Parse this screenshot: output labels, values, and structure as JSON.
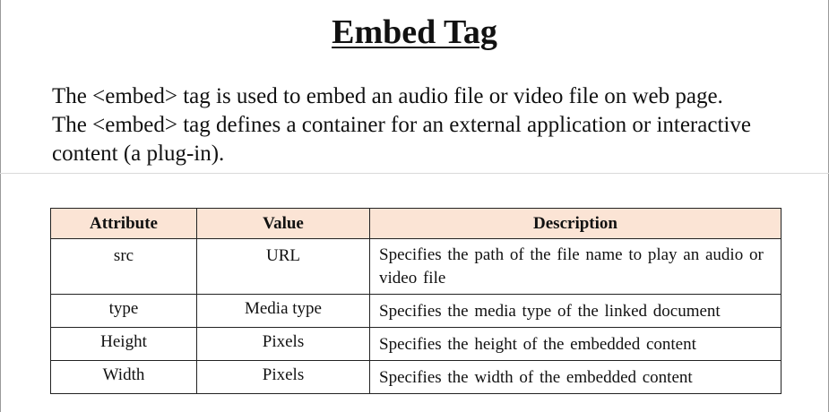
{
  "title": "Embed Tag",
  "intro": {
    "line1": "The <embed> tag is used to embed an audio file or video file on web page.",
    "line2": "The <embed> tag defines a container for an external application or interactive content (a plug-in)."
  },
  "table": {
    "headers": [
      "Attribute",
      "Value",
      "Description"
    ],
    "rows": [
      [
        "src",
        "URL",
        "Specifies the path of the file name to play an audio or video file"
      ],
      [
        "type",
        "Media type",
        "Specifies the media type of the linked document"
      ],
      [
        "Height",
        "Pixels",
        "Specifies the height of the embedded content"
      ],
      [
        "Width",
        "Pixels",
        "Specifies the width of the embedded content"
      ]
    ]
  }
}
